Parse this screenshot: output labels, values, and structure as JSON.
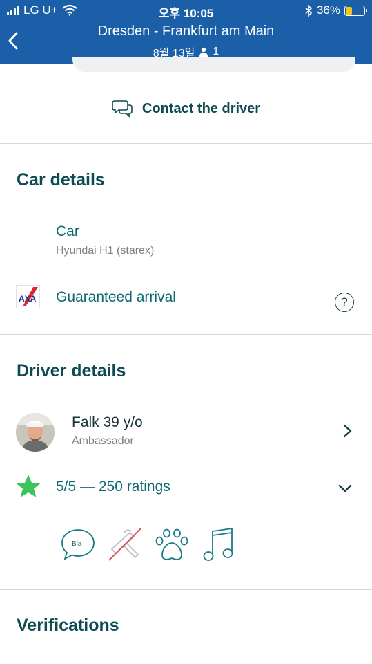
{
  "status_bar": {
    "carrier": "LG U+",
    "time": "오후 10:05",
    "battery_percent": "36%",
    "battery_level": 0.36
  },
  "header": {
    "title": "Dresden - Frankfurt am Main",
    "date": "8월 13일",
    "passengers": "1"
  },
  "contact": {
    "label": "Contact the driver"
  },
  "car_details": {
    "title": "Car details",
    "car_label": "Car",
    "car_model": "Hyundai H1 (starex)",
    "arrival_label": "Guaranteed arrival",
    "arrival_logo_text": "AXA",
    "help_icon_text": "?"
  },
  "driver_details": {
    "title": "Driver details",
    "driver_name": "Falk 39 y/o",
    "driver_level": "Ambassador",
    "rating_text": "5/5 — 250 ratings",
    "chat_icon_text": "Bla"
  },
  "verifications": {
    "title": "Verifications"
  },
  "colors": {
    "header_bg": "#1a5fa8",
    "teal_text": "#0d6a73",
    "dark_text": "#0d4a52",
    "star_green": "#3cc35b",
    "crossed_red": "#e04343"
  }
}
